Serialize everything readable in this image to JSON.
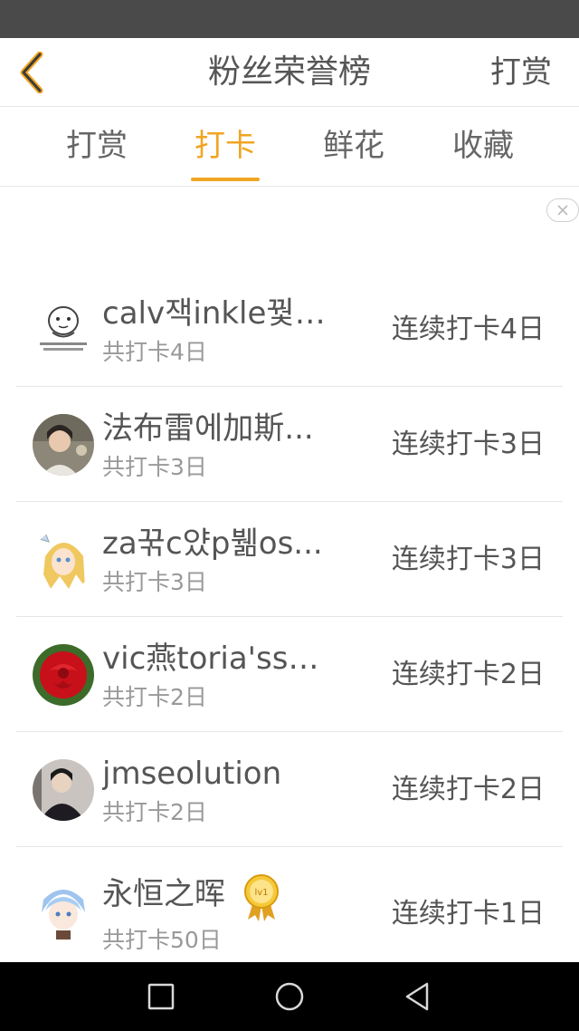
{
  "header": {
    "title": "粉丝荣誉榜",
    "action_label": "打赏"
  },
  "tabs": [
    {
      "label": "打赏",
      "active": false
    },
    {
      "label": "打卡",
      "active": true
    },
    {
      "label": "鲜花",
      "active": false
    },
    {
      "label": "收藏",
      "active": false
    }
  ],
  "colors": {
    "accent": "#f0a522",
    "status_bar": "#4a4a4a",
    "nav_bar": "#000000"
  },
  "list": [
    {
      "name": "calv잭inkle꿫i...",
      "total": "共打卡4日",
      "streak": "连续打卡4日",
      "avatar": "meme-avatar"
    },
    {
      "name": "法布雷에加斯...",
      "total": "共打卡3日",
      "streak": "连续打卡3日",
      "avatar": "photo-avatar"
    },
    {
      "name": "za꾺c얐p뷂os...",
      "total": "共打卡3日",
      "streak": "连续打卡3日",
      "avatar": "anime-girl-avatar"
    },
    {
      "name": "vic燕toria'sse...",
      "total": "共打卡2日",
      "streak": "连续打卡2日",
      "avatar": "rose-avatar"
    },
    {
      "name": "jmseolution",
      "total": "共打卡2日",
      "streak": "连续打卡2日",
      "avatar": "photo-avatar"
    },
    {
      "name": "永恒之晖",
      "total": "共打卡50日",
      "streak": "连续打卡1日",
      "avatar": "anime-boy-avatar",
      "badge": "lv1"
    }
  ]
}
